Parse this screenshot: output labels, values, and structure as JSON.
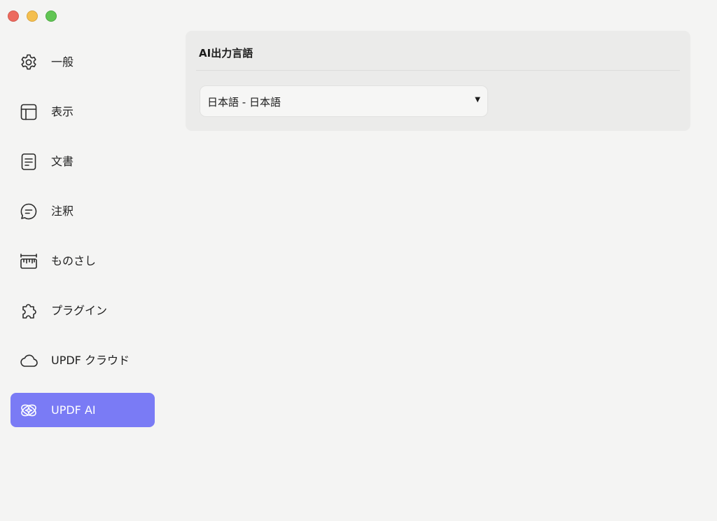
{
  "window": {
    "controls": [
      "close",
      "minimize",
      "zoom"
    ]
  },
  "sidebar": {
    "items": [
      {
        "label": "一般",
        "icon": "gear-icon",
        "active": false
      },
      {
        "label": "表示",
        "icon": "layout-icon",
        "active": false
      },
      {
        "label": "文書",
        "icon": "document-icon",
        "active": false
      },
      {
        "label": "注釈",
        "icon": "comment-icon",
        "active": false
      },
      {
        "label": "ものさし",
        "icon": "ruler-icon",
        "active": false
      },
      {
        "label": "プラグイン",
        "icon": "puzzle-icon",
        "active": false
      },
      {
        "label": "UPDF クラウド",
        "icon": "cloud-icon",
        "active": false
      },
      {
        "label": "UPDF AI",
        "icon": "ai-sparkle-icon",
        "active": true
      }
    ]
  },
  "main": {
    "section_title": "AI出力言語",
    "language_select": {
      "selected": "日本語 - 日本語"
    }
  },
  "colors": {
    "accent": "#7a7bf5",
    "background": "#f4f4f3",
    "panel": "#ebebea"
  }
}
